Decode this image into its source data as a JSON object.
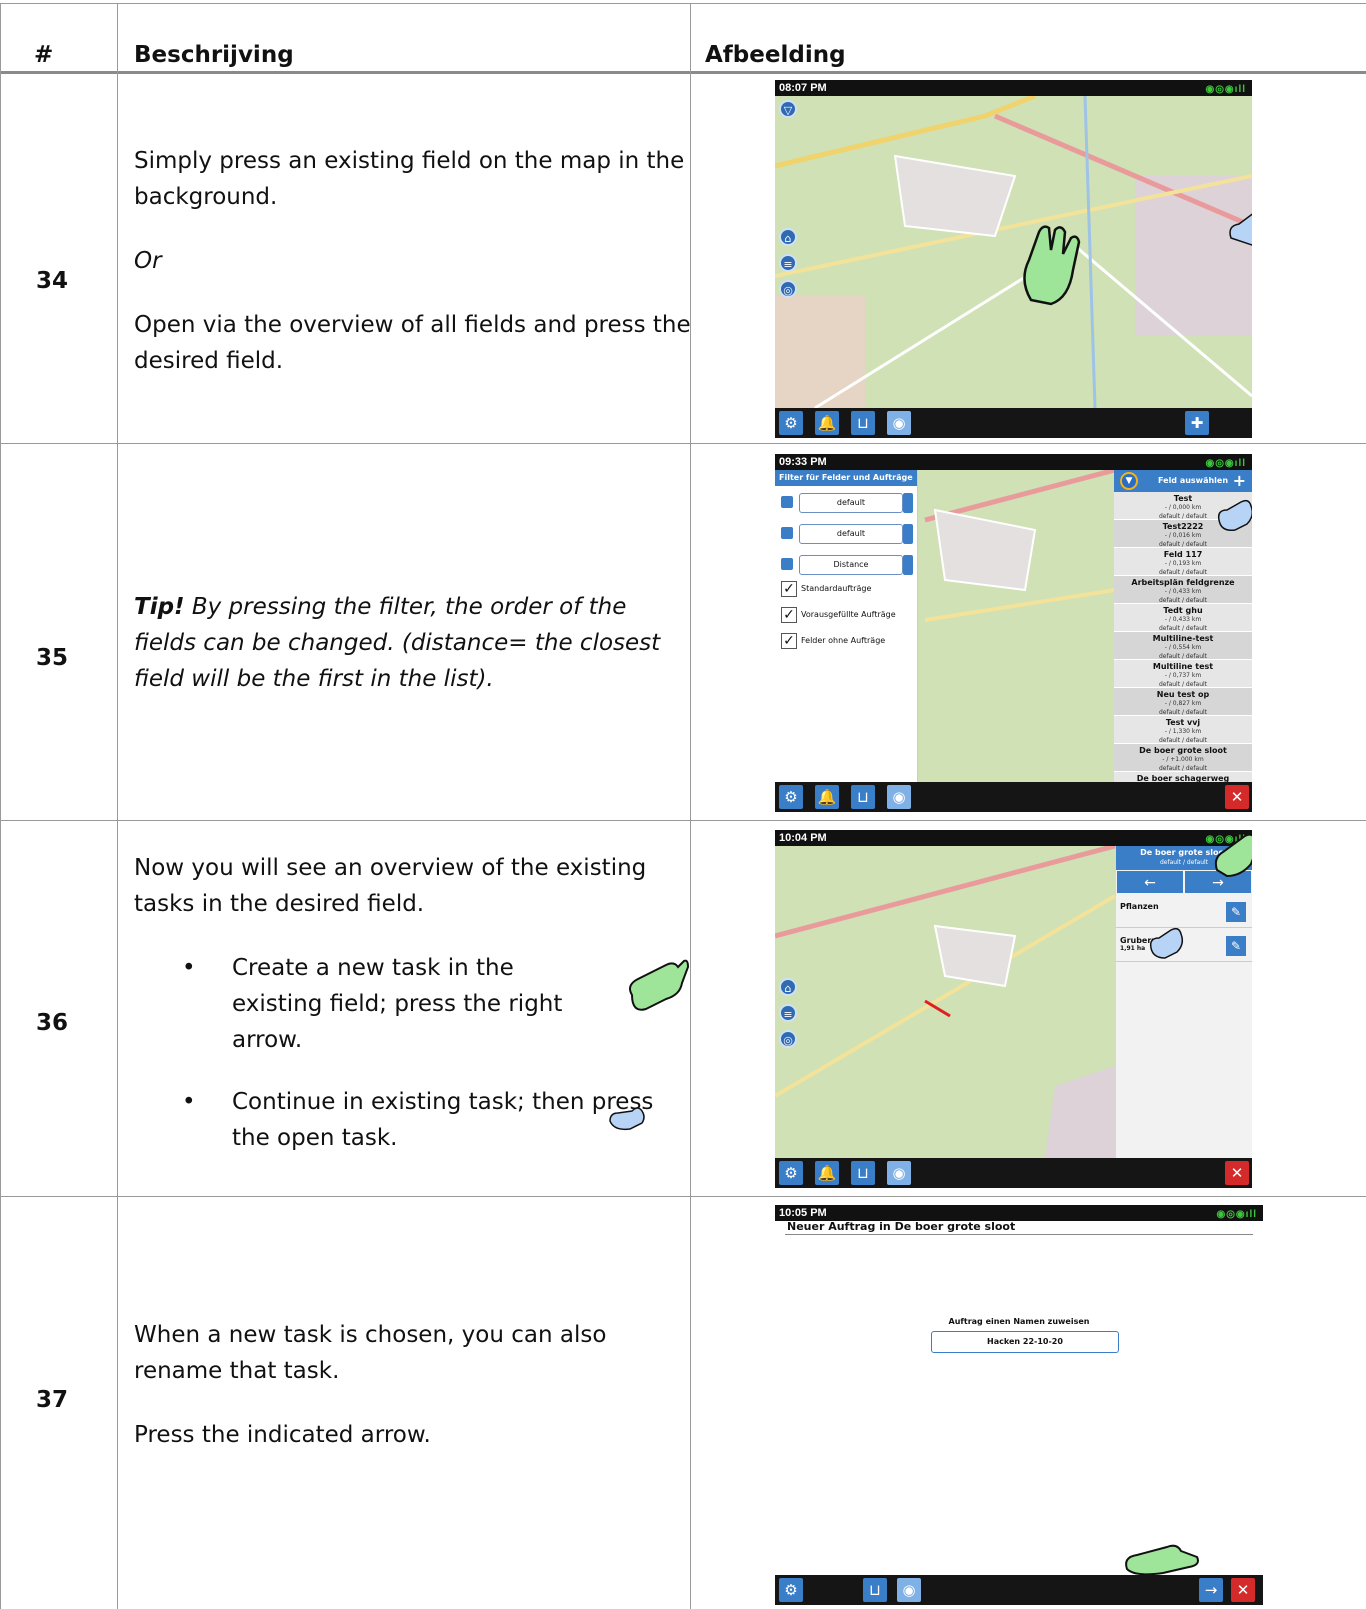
{
  "table": {
    "headers": {
      "num": "#",
      "desc": "Beschrijving",
      "image": "Afbeelding"
    },
    "rows": [
      {
        "num": "34",
        "p1": "Simply press an existing field on the map in the background.",
        "p2": "Or",
        "p3": "Open via the overview of all fields and press the desired field."
      },
      {
        "num": "35",
        "tip": "Tip!",
        "text": "By pressing the filter, the order of the fields can be changed. (distance= the closest field will be the first in the list)."
      },
      {
        "num": "36",
        "intro": "Now you will see an overview of the existing tasks in the desired field.",
        "bullet1": "Create a new task in the existing field; press the right arrow.",
        "bullet2": "Continue in existing task; then press the open task."
      },
      {
        "num": "37",
        "p1": "When a new task is chosen, you can also rename that task.",
        "p2": "Press the indicated arrow."
      }
    ]
  },
  "screens": {
    "s34": {
      "time": "08:07 PM"
    },
    "s35": {
      "time": "09:33 PM",
      "filter_title": "Filter für Felder und Aufträge",
      "select1": "default",
      "select2": "default",
      "select3": "Distance",
      "check1": "Standardaufträge",
      "check2": "Vorausgefüllte Aufträge",
      "check3": "Felder ohne Aufträge",
      "list_title": "Feld auswählen",
      "fields": [
        {
          "name": "Test",
          "dist": "- / 0,000 km",
          "meta": "default / default"
        },
        {
          "name": "Test2222",
          "dist": "- / 0,016 km",
          "meta": "default / default"
        },
        {
          "name": "Feld 117",
          "dist": "- / 0,193 km",
          "meta": "default / default"
        },
        {
          "name": "Arbeitsplän feldgrenze",
          "dist": "- / 0,433 km",
          "meta": "default / default"
        },
        {
          "name": "Tedt ghu",
          "dist": "- / 0,433 km",
          "meta": "default / default"
        },
        {
          "name": "Multiline-test",
          "dist": "- / 0,554 km",
          "meta": "default / default"
        },
        {
          "name": "Multiline test",
          "dist": "- / 0,737 km",
          "meta": "default / default"
        },
        {
          "name": "Neu test op",
          "dist": "- / 0,827 km",
          "meta": "default / default"
        },
        {
          "name": "Test vvj",
          "dist": "- / 1,330 km",
          "meta": "default / default"
        },
        {
          "name": "De boer grote sloot",
          "dist": "- / +1.000 km",
          "meta": "default / default"
        },
        {
          "name": "De boer schagerweg",
          "dist": "",
          "meta": ""
        }
      ]
    },
    "s36": {
      "time": "10:04 PM",
      "field_name": "De boer grote sloot",
      "field_meta": "default / default",
      "task1": "Pflanzen",
      "task2": "Grubern",
      "task2_area": "1,91 ha"
    },
    "s37": {
      "time": "10:05 PM",
      "title": "Neuer Auftrag in De boer grote sloot",
      "rename_label": "Auftrag einen Namen zuweisen",
      "rename_value": "Hacken 22-10-20"
    }
  },
  "colors": {
    "accent": "#3a7ec8",
    "close": "#d42a2a",
    "hand": "#9ee59a",
    "map": "#cfe1b5"
  }
}
